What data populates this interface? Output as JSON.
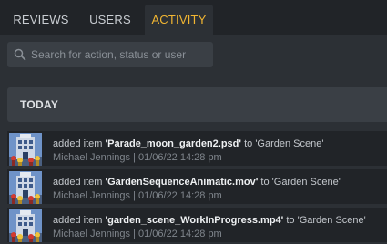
{
  "tabs": [
    {
      "label": "REVIEWS",
      "active": false
    },
    {
      "label": "USERS",
      "active": false
    },
    {
      "label": "ACTIVITY",
      "active": true
    }
  ],
  "search": {
    "placeholder": "Search for action, status or user",
    "value": ""
  },
  "section": {
    "title": "TODAY"
  },
  "colors": {
    "accent": "#f2b632",
    "background": "#2c3035",
    "row": "#212428"
  },
  "activity": [
    {
      "action": "added item",
      "file": "'Parade_moon_garden2.psd'",
      "to": "to",
      "target": "'Garden Scene'",
      "user": "Michael Jennings",
      "sep": "|",
      "datetime": "01/06/22 14:28 pm",
      "icon": "building-thumbnail-icon"
    },
    {
      "action": "added item",
      "file": "'GardenSequenceAnimatic.mov'",
      "to": "to",
      "target": "'Garden Scene'",
      "user": "Michael Jennings",
      "sep": "|",
      "datetime": "01/06/22 14:28 pm",
      "icon": "building-thumbnail-icon"
    },
    {
      "action": "added item",
      "file": "'garden_scene_WorkInProgress.mp4'",
      "to": "to",
      "target": "'Garden Scene'",
      "user": "Michael Jennings",
      "sep": "|",
      "datetime": "01/06/22 14:28 pm",
      "icon": "building-thumbnail-icon"
    }
  ]
}
